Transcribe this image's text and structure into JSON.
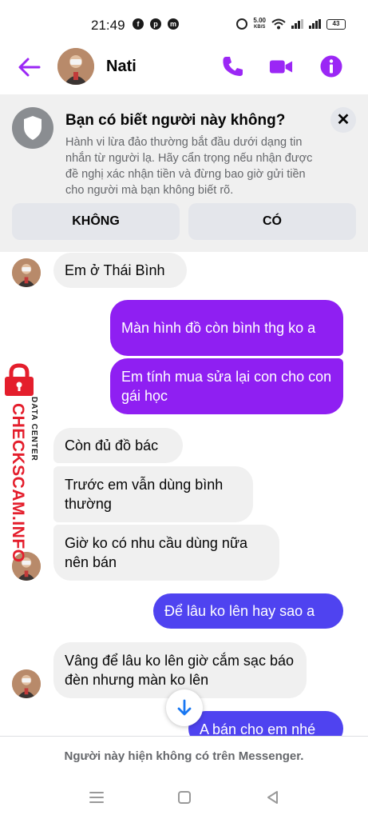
{
  "status_bar": {
    "time": "21:49",
    "app_icons": [
      "f",
      "p",
      "m"
    ],
    "net_speed_value": "5.00",
    "net_speed_unit": "KB/S",
    "battery": "43"
  },
  "header": {
    "contact_name": "Nati",
    "accent_color": "#9b27f5"
  },
  "stranger_card": {
    "title": "Bạn có biết người này không?",
    "description": "Hành vi lừa đảo thường bắt đầu dưới dạng tin nhắn từ người lạ. Hãy cẩn trọng nếu nhận được đề nghị xác nhận tiền và đừng bao giờ gửi tiền cho người mà bạn không biết rõ.",
    "no_label": "KHÔNG",
    "yes_label": "CÓ",
    "close_glyph": "✕"
  },
  "messages": [
    {
      "direction": "incoming",
      "text": "Em ở Thái Bình"
    },
    {
      "direction": "outgoing",
      "text": "Màn hình đồ còn bình thg ko a"
    },
    {
      "direction": "outgoing",
      "text": "Em tính mua sửa lại con cho con gái học"
    },
    {
      "direction": "incoming",
      "text": "Còn đủ đồ bác"
    },
    {
      "direction": "incoming",
      "text": "Trước em vẫn dùng bình thường"
    },
    {
      "direction": "incoming",
      "text": "Giờ ko có nhu cầu dùng nữa nên bán"
    },
    {
      "direction": "outgoing",
      "text": "Để lâu ko lên hay sao a"
    },
    {
      "direction": "incoming",
      "text": "Vâng để lâu ko lên giờ cắm sạc báo đèn nhưng màn ko lên"
    },
    {
      "direction": "outgoing",
      "text": "A bán cho em nhé"
    }
  ],
  "watermark": {
    "main": "CHECKSCAM.INFO",
    "sub": "DATA CENTER",
    "color": "#e41e2c"
  },
  "footer": {
    "text": "Người này hiện không có trên Messenger."
  },
  "colors": {
    "outgoing_purple": "#8f1ff2",
    "outgoing_blue": "#4f43f0",
    "incoming_bg": "#f0f0f0"
  }
}
